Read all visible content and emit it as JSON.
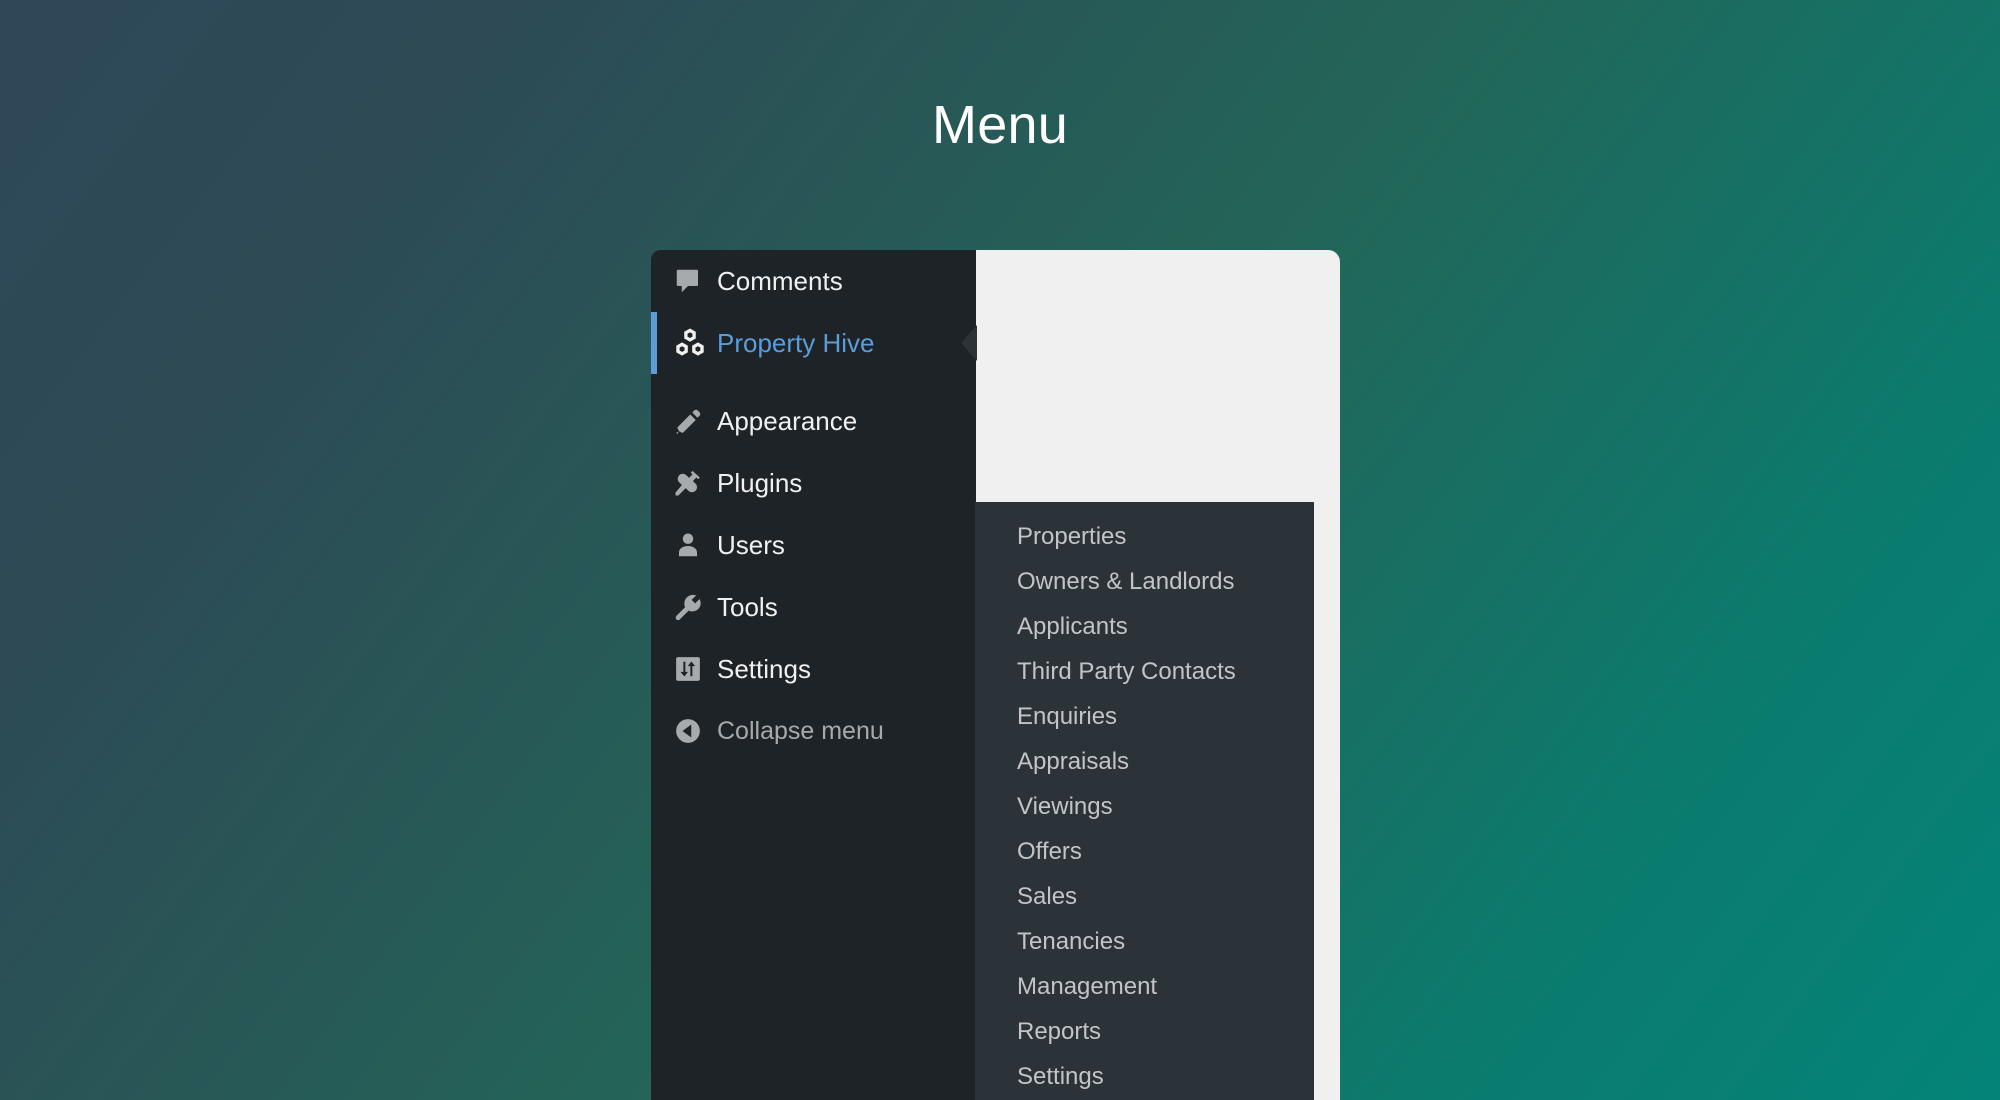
{
  "page": {
    "title": "Menu"
  },
  "theme": {
    "background_start": "#2f4858",
    "background_end": "#048478",
    "sidebar_bg": "#1d2327",
    "submenu_bg": "#2c3338",
    "content_bg": "#f0f0f1",
    "accent": "#5b9dd9",
    "text": "#f0f0f1",
    "submenu_text": "#c3c4c7"
  },
  "sidebar": {
    "items": [
      {
        "label": "Comments",
        "icon": "comment-icon",
        "state": "default"
      },
      {
        "label": "Property Hive",
        "icon": "hexagons-icon",
        "state": "current"
      },
      {
        "label": "Appearance",
        "icon": "paintbrush-icon",
        "state": "default"
      },
      {
        "label": "Plugins",
        "icon": "plug-icon",
        "state": "default"
      },
      {
        "label": "Users",
        "icon": "user-icon",
        "state": "default"
      },
      {
        "label": "Tools",
        "icon": "wrench-icon",
        "state": "default"
      },
      {
        "label": "Settings",
        "icon": "sliders-icon",
        "state": "default"
      },
      {
        "label": "Collapse menu",
        "icon": "collapse-left-icon",
        "state": "muted"
      }
    ]
  },
  "submenu": {
    "parent": "Property Hive",
    "items": [
      {
        "label": "Properties"
      },
      {
        "label": "Owners & Landlords"
      },
      {
        "label": "Applicants"
      },
      {
        "label": "Third Party Contacts"
      },
      {
        "label": "Enquiries"
      },
      {
        "label": "Appraisals"
      },
      {
        "label": "Viewings"
      },
      {
        "label": "Offers"
      },
      {
        "label": "Sales"
      },
      {
        "label": "Tenancies"
      },
      {
        "label": "Management"
      },
      {
        "label": "Reports"
      },
      {
        "label": "Settings"
      }
    ]
  }
}
